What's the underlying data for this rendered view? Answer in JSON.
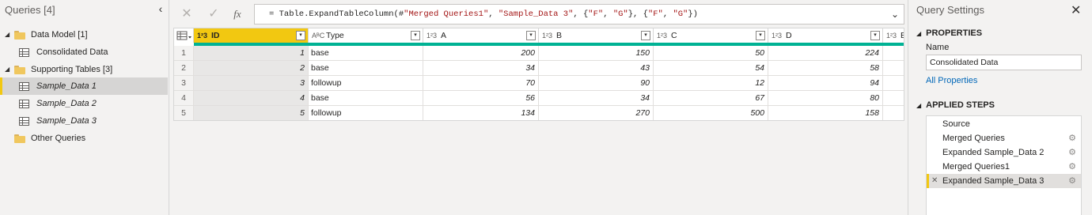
{
  "queries_pane": {
    "header": "Queries [4]",
    "collapse_icon": "‹",
    "tree": [
      {
        "label": "Data Model [1]",
        "kind": "folder",
        "expanded": true
      },
      {
        "label": "Consolidated Data",
        "kind": "table"
      },
      {
        "label": "Supporting Tables [3]",
        "kind": "folder",
        "expanded": true
      },
      {
        "label": "Sample_Data 1",
        "kind": "table",
        "selected": true
      },
      {
        "label": "Sample_Data 2",
        "kind": "table"
      },
      {
        "label": "Sample_Data 3",
        "kind": "table"
      },
      {
        "label": "Other Queries",
        "kind": "folder",
        "expanded": false
      }
    ]
  },
  "formula_bar": {
    "cancel_icon": "✕",
    "commit_icon": "✓",
    "fx_label": "fx",
    "formula_parts": [
      {
        "text": "= Table.ExpandTableColumn(#",
        "kind": "plain"
      },
      {
        "text": "\"Merged Queries1\"",
        "kind": "string"
      },
      {
        "text": ", ",
        "kind": "plain"
      },
      {
        "text": "\"Sample_Data 3\"",
        "kind": "string"
      },
      {
        "text": ", {",
        "kind": "plain"
      },
      {
        "text": "\"F\"",
        "kind": "string"
      },
      {
        "text": ", ",
        "kind": "plain"
      },
      {
        "text": "\"G\"",
        "kind": "string"
      },
      {
        "text": "}, {",
        "kind": "plain"
      },
      {
        "text": "\"F\"",
        "kind": "string"
      },
      {
        "text": ", ",
        "kind": "plain"
      },
      {
        "text": "\"G\"",
        "kind": "string"
      },
      {
        "text": "})",
        "kind": "plain"
      }
    ],
    "expand_icon": "⌄"
  },
  "grid": {
    "columns": [
      {
        "type_icon": "1²3",
        "name": "ID",
        "kind": "number"
      },
      {
        "type_icon": "AᴮC",
        "name": "Type",
        "kind": "text"
      },
      {
        "type_icon": "1²3",
        "name": "A",
        "kind": "number"
      },
      {
        "type_icon": "1²3",
        "name": "B",
        "kind": "number"
      },
      {
        "type_icon": "1²3",
        "name": "C",
        "kind": "number"
      },
      {
        "type_icon": "1²3",
        "name": "D",
        "kind": "number"
      },
      {
        "type_icon": "1²3",
        "name": "B",
        "kind": "number"
      }
    ],
    "rows": [
      {
        "num": "1",
        "cells": [
          "1",
          "base",
          "200",
          "150",
          "50",
          "224"
        ]
      },
      {
        "num": "2",
        "cells": [
          "2",
          "base",
          "34",
          "43",
          "54",
          "58"
        ]
      },
      {
        "num": "3",
        "cells": [
          "3",
          "followup",
          "70",
          "90",
          "12",
          "94"
        ]
      },
      {
        "num": "4",
        "cells": [
          "4",
          "base",
          "56",
          "34",
          "67",
          "80"
        ]
      },
      {
        "num": "5",
        "cells": [
          "5",
          "followup",
          "134",
          "270",
          "500",
          "158"
        ]
      }
    ],
    "filter_icon": "▾",
    "accent_color": "#f2c811",
    "quality_color": "#00b294"
  },
  "settings_pane": {
    "title": "Query Settings",
    "close_icon": "✕",
    "properties_header": "PROPERTIES",
    "name_label": "Name",
    "name_value": "Consolidated Data",
    "all_properties_link": "All Properties",
    "steps_header": "APPLIED STEPS",
    "steps": [
      {
        "label": "Source",
        "has_gear": false,
        "selected": false
      },
      {
        "label": "Merged Queries",
        "has_gear": true,
        "selected": false
      },
      {
        "label": "Expanded Sample_Data 2",
        "has_gear": true,
        "selected": false
      },
      {
        "label": "Merged Queries1",
        "has_gear": true,
        "selected": false
      },
      {
        "label": "Expanded Sample_Data 3",
        "has_gear": true,
        "selected": true
      }
    ]
  }
}
